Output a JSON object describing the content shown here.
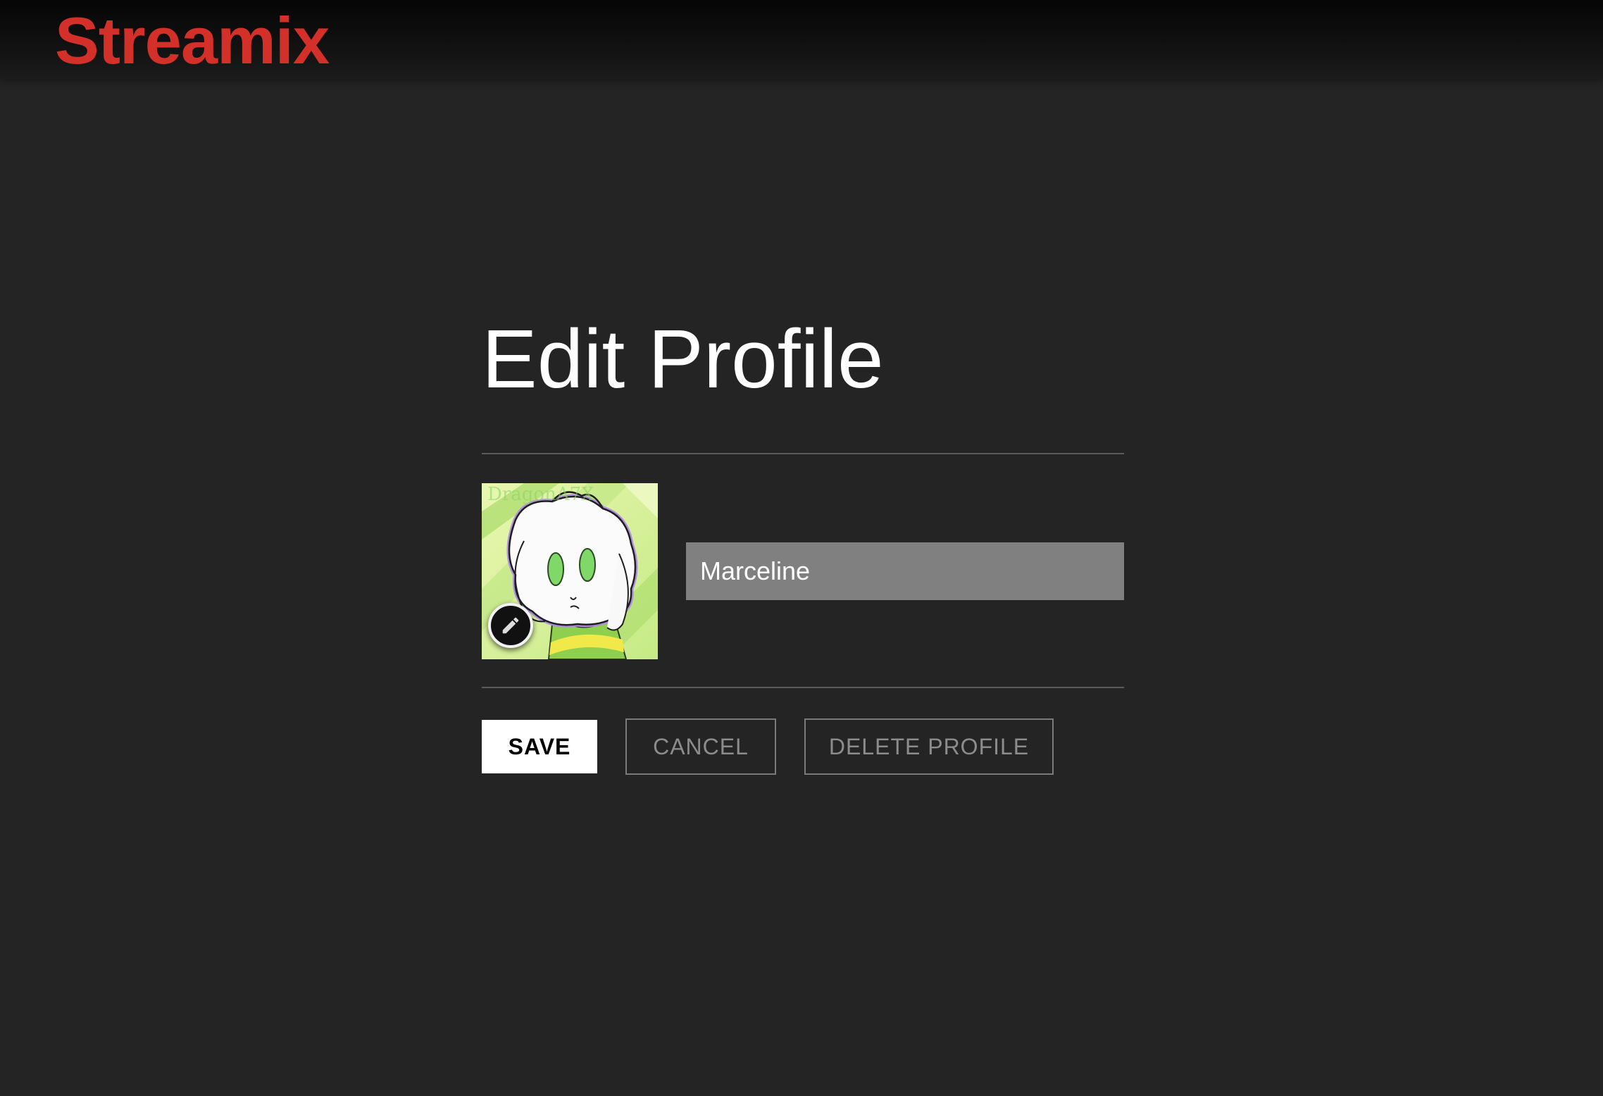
{
  "header": {
    "logo": "Streamix",
    "logo_color": "#d3302a"
  },
  "main": {
    "title": "Edit Profile",
    "avatar": {
      "description_icon": "profile-avatar-image",
      "edit_icon": "pencil-icon"
    },
    "name_input": {
      "value": "Marceline"
    },
    "buttons": {
      "save": "SAVE",
      "cancel": "CANCEL",
      "delete": "DELETE PROFILE"
    }
  },
  "colors": {
    "background": "#242424",
    "input_background": "#808080",
    "save_background": "#ffffff",
    "outline_button_text": "#8c8c8c"
  }
}
